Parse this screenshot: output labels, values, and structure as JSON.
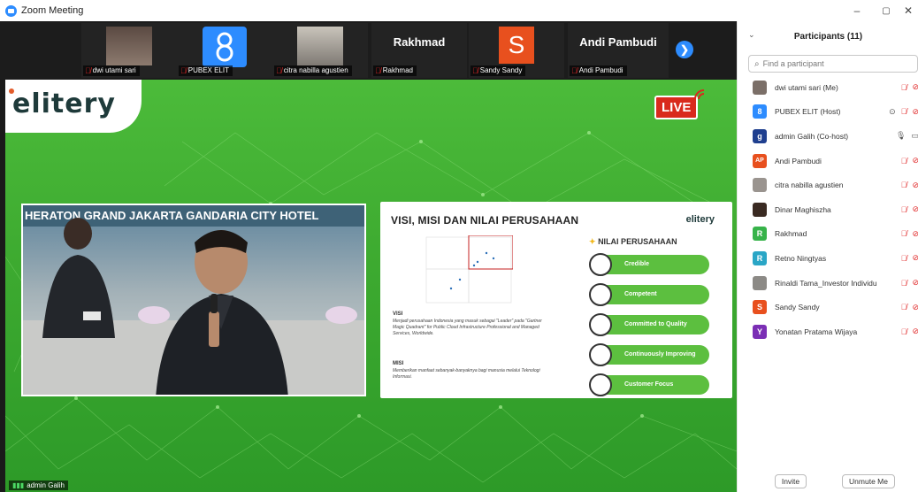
{
  "window": {
    "title": "Zoom Meeting",
    "controls": {
      "minimize": "–",
      "maximize": "▢",
      "close": "✕"
    }
  },
  "strip": {
    "tiles": [
      {
        "name": "dwi utami sari",
        "kind": "photo",
        "color": "#6f6a66"
      },
      {
        "name": "PUBEX ELIT",
        "kind": "logo",
        "color": "#2d8cff"
      },
      {
        "name": "citra nabilla agustien",
        "kind": "photo",
        "color": "#8a8580"
      },
      {
        "name": "Rakhmad",
        "kind": "text",
        "display": "Rakhmad"
      },
      {
        "name": "Sandy Sandy",
        "kind": "letter",
        "display": "S",
        "color": "#e8501e"
      },
      {
        "name": "Andi Pambudi",
        "kind": "text",
        "display": "Andi Pambudi"
      }
    ],
    "next_icon": "chevron-right"
  },
  "main": {
    "logo": "elitery",
    "live_badge": "LIVE",
    "cam_banner": "HERATON GRAND JAKARTA GANDARIA CITY HOTEL",
    "speaker_label": "admin Galih",
    "slide": {
      "title": "VISI, MISI DAN NILAI PERUSAHAAN",
      "logo": "elitery",
      "values_heading": "NILAI PERUSAHAAN",
      "visi_heading": "VISI",
      "visi_text": "Menjadi perusahaan Indonesia yang masuk sebagai \"Leader\" pada \"Gartner Magic Quadrant\" for Public Cloud Infrastructure Professional and Managed Services, Worldwide.",
      "misi_heading": "MISI",
      "misi_text": "Memberikan manfaat sebanyak-banyaknya bagi manusia melalui Teknologi Informasi.",
      "values": [
        "Credible",
        "Competent",
        "Committed to Quality",
        "Continuously Improving",
        "Customer Focus"
      ]
    }
  },
  "participants": {
    "title": "Participants (11)",
    "search_placeholder": "Find a participant",
    "list": [
      {
        "name": "dwi utami sari (Me)",
        "avatar": "",
        "avatar_color": "#7b6f68",
        "muted": true,
        "video_off": true
      },
      {
        "name": "PUBEX ELIT (Host)",
        "avatar": "8",
        "avatar_color": "#2d8cff",
        "muted": true,
        "video_off": true,
        "share": true
      },
      {
        "name": "admin Galih (Co-host)",
        "avatar": "g",
        "avatar_color": "#1f3f8f",
        "muted": false,
        "video_off": false
      },
      {
        "name": "Andi Pambudi",
        "avatar": "AP",
        "avatar_color": "#e8501e",
        "muted": true,
        "video_off": true
      },
      {
        "name": "citra nabilla agustien",
        "avatar": "",
        "avatar_color": "#9a948f",
        "muted": true,
        "video_off": true
      },
      {
        "name": "Dinar Maghiszha",
        "avatar": "",
        "avatar_color": "#3a2a22",
        "muted": true,
        "video_off": true
      },
      {
        "name": "Rakhmad",
        "avatar": "R",
        "avatar_color": "#37b34a",
        "muted": true,
        "video_off": true
      },
      {
        "name": "Retno Ningtyas",
        "avatar": "R",
        "avatar_color": "#2aa6c6",
        "muted": true,
        "video_off": true
      },
      {
        "name": "Rinaldi Tama_Investor Individu",
        "avatar": "",
        "avatar_color": "#8c8a86",
        "muted": true,
        "video_off": true
      },
      {
        "name": "Sandy Sandy",
        "avatar": "S",
        "avatar_color": "#e8501e",
        "muted": true,
        "video_off": true
      },
      {
        "name": "Yonatan Pratama Wijaya",
        "avatar": "Y",
        "avatar_color": "#7b2fb5",
        "muted": true,
        "video_off": true
      }
    ],
    "invite_label": "Invite",
    "unmute_label": "Unmute Me"
  }
}
